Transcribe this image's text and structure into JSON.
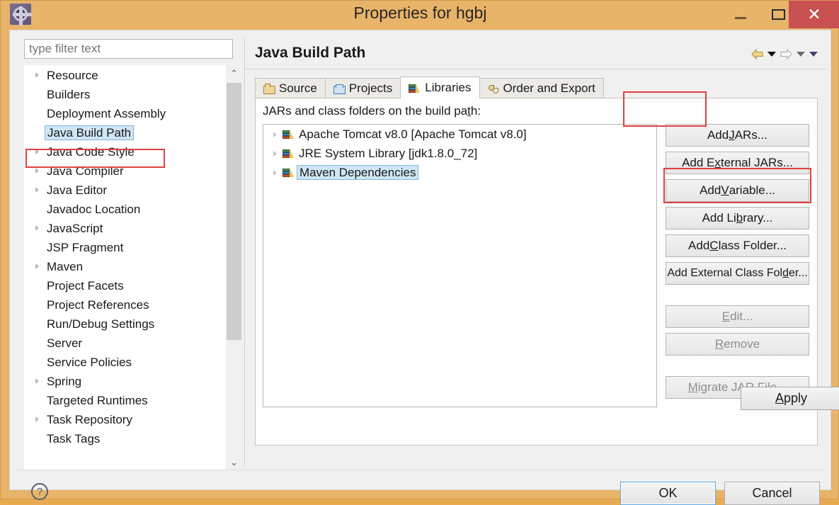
{
  "window": {
    "title": "Properties for hgbj",
    "app_icon": "gear-icon",
    "minimize_label": "—",
    "maximize_label": "□",
    "close_label": "✕",
    "accent_close": "#c85050",
    "titlebar_color": "#e8b469"
  },
  "sidebar": {
    "filter": {
      "placeholder": "type filter text",
      "value": ""
    },
    "items": [
      {
        "label": "Resource",
        "expandable": true,
        "selected": false
      },
      {
        "label": "Builders",
        "expandable": false,
        "selected": false
      },
      {
        "label": "Deployment Assembly",
        "expandable": false,
        "selected": false
      },
      {
        "label": "Java Build Path",
        "expandable": false,
        "selected": true
      },
      {
        "label": "Java Code Style",
        "expandable": true,
        "selected": false
      },
      {
        "label": "Java Compiler",
        "expandable": true,
        "selected": false
      },
      {
        "label": "Java Editor",
        "expandable": true,
        "selected": false
      },
      {
        "label": "Javadoc Location",
        "expandable": false,
        "selected": false
      },
      {
        "label": "JavaScript",
        "expandable": true,
        "selected": false
      },
      {
        "label": "JSP Fragment",
        "expandable": false,
        "selected": false
      },
      {
        "label": "Maven",
        "expandable": true,
        "selected": false
      },
      {
        "label": "Project Facets",
        "expandable": false,
        "selected": false
      },
      {
        "label": "Project References",
        "expandable": false,
        "selected": false
      },
      {
        "label": "Run/Debug Settings",
        "expandable": false,
        "selected": false
      },
      {
        "label": "Server",
        "expandable": false,
        "selected": false
      },
      {
        "label": "Service Policies",
        "expandable": false,
        "selected": false
      },
      {
        "label": "Spring",
        "expandable": true,
        "selected": false
      },
      {
        "label": "Targeted Runtimes",
        "expandable": false,
        "selected": false
      },
      {
        "label": "Task Repository",
        "expandable": true,
        "selected": false
      },
      {
        "label": "Task Tags",
        "expandable": false,
        "selected": false
      }
    ],
    "scrollbar": {
      "up_arrow": "⌃",
      "down_arrow": "⌄"
    }
  },
  "main": {
    "page_title": "Java Build Path",
    "nav": {
      "back_icon": "back-arrow-icon",
      "back_menu_icon": "chevron-down-icon",
      "forward_icon": "forward-arrow-icon",
      "forward_menu_icon": "chevron-down-icon",
      "more_menu_icon": "chevron-down-icon"
    },
    "tabs": [
      {
        "label": "Source",
        "icon": "source-folder-icon",
        "active": false
      },
      {
        "label": "Projects",
        "icon": "project-folder-icon",
        "active": false
      },
      {
        "label": "Libraries",
        "icon": "library-books-icon",
        "active": true
      },
      {
        "label": "Order and Export",
        "icon": "order-export-icon",
        "active": false
      }
    ],
    "list_label": {
      "before": "JARs and class folders on the build pa",
      "accel": "t",
      "after": "h:"
    },
    "libraries": [
      {
        "label": "Apache Tomcat v8.0 [Apache Tomcat v8.0]",
        "icon": "library-books-icon",
        "expandable": true,
        "selected": false
      },
      {
        "label": "JRE System Library [jdk1.8.0_72]",
        "icon": "library-books-icon",
        "expandable": true,
        "selected": false
      },
      {
        "label": "Maven Dependencies",
        "icon": "library-books-icon",
        "expandable": true,
        "selected": true
      }
    ],
    "side_buttons": [
      {
        "before": "Add ",
        "accel": "J",
        "after": "ARs...",
        "enabled": true,
        "gap_after": false
      },
      {
        "before": "Add E",
        "accel": "x",
        "after": "ternal JARs...",
        "enabled": true,
        "gap_after": false
      },
      {
        "before": "Add ",
        "accel": "V",
        "after": "ariable...",
        "enabled": true,
        "gap_after": false
      },
      {
        "before": "Add Li",
        "accel": "b",
        "after": "rary...",
        "enabled": true,
        "gap_after": false
      },
      {
        "before": "Add ",
        "accel": "C",
        "after": "lass Folder...",
        "enabled": true,
        "gap_after": false
      },
      {
        "before": "Add External Class Fol",
        "accel": "d",
        "after": "er...",
        "enabled": true,
        "gap_after": true
      },
      {
        "before": "",
        "accel": "E",
        "after": "dit...",
        "enabled": false,
        "gap_after": false
      },
      {
        "before": "",
        "accel": "R",
        "after": "emove",
        "enabled": false,
        "gap_after": true
      },
      {
        "before": "",
        "accel": "M",
        "after": "igrate JAR File...",
        "enabled": false,
        "gap_after": false
      }
    ],
    "apply": {
      "accel": "A",
      "after": "pply"
    }
  },
  "footer": {
    "help_icon": "question-mark-icon",
    "ok_label": "OK",
    "cancel_label": "Cancel"
  },
  "annotations": {
    "highlight_color": "#e04040",
    "boxes": [
      "java-build-path-tree-item",
      "libraries-tab",
      "add-library-button"
    ]
  }
}
